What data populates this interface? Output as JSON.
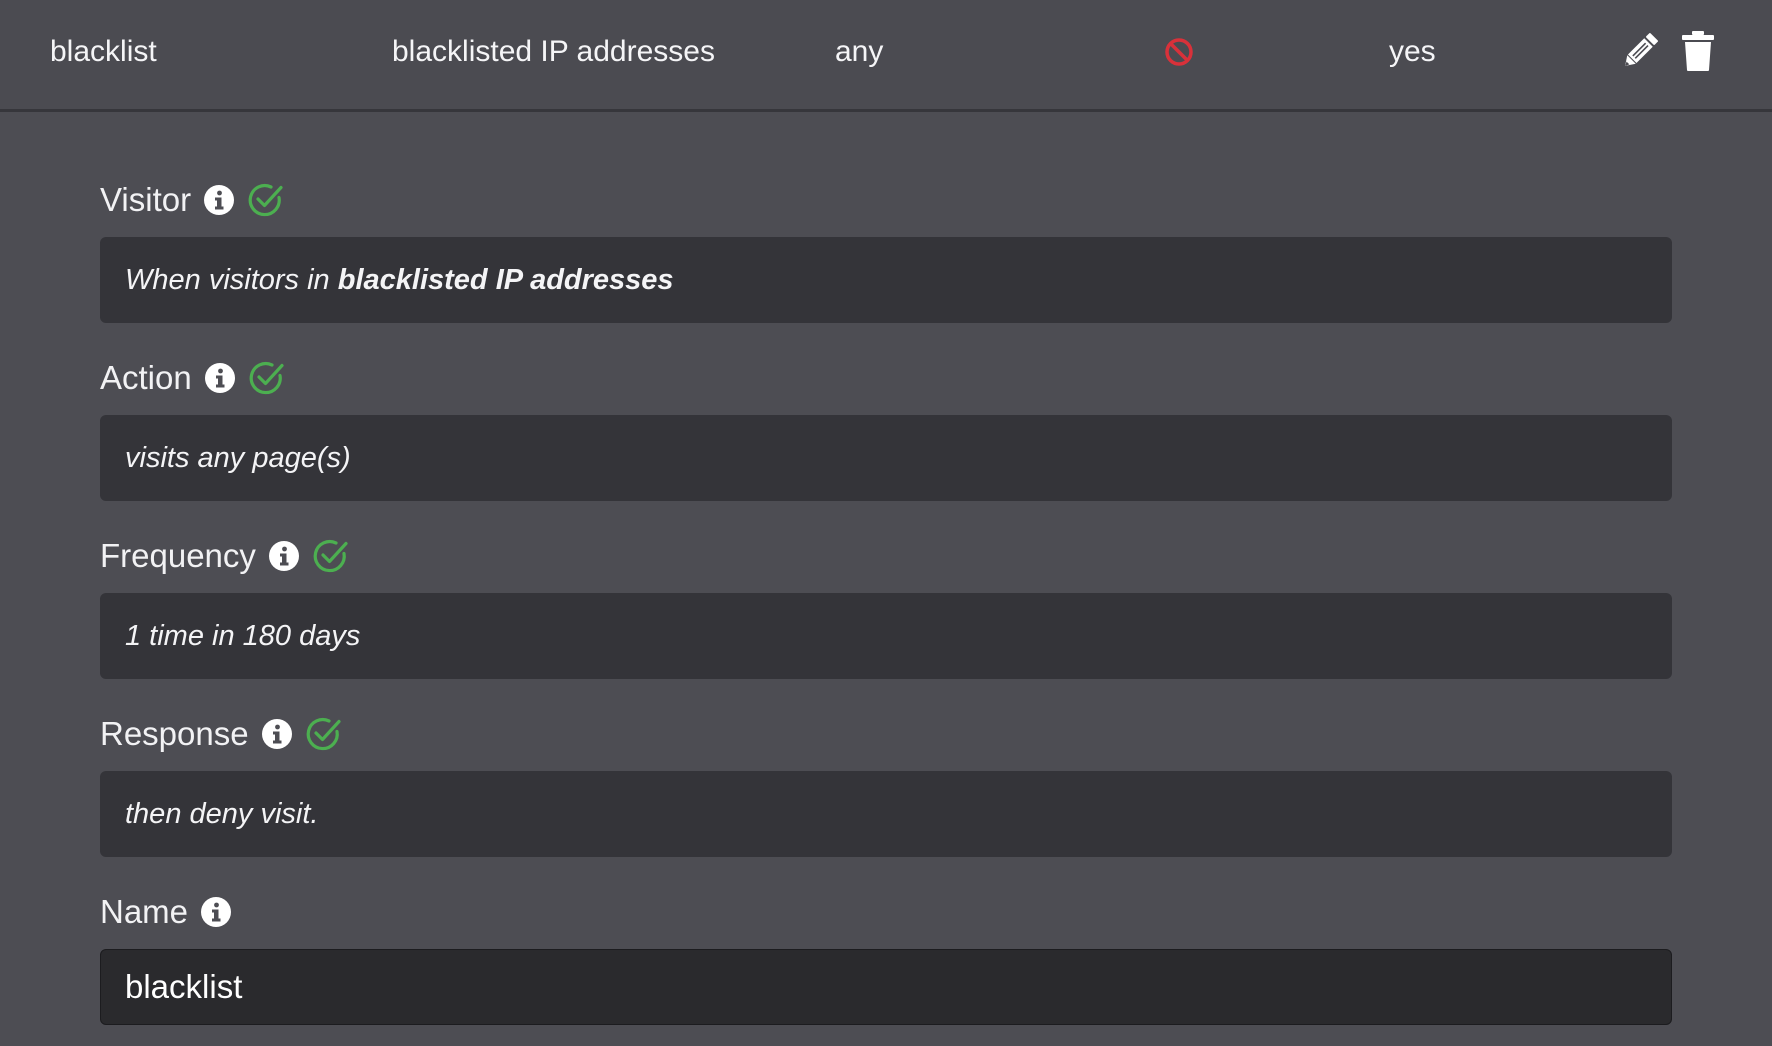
{
  "rule_row": {
    "name": "blacklist",
    "visitor": "blacklisted IP addresses",
    "action": "any",
    "status_icon": "blocked-icon",
    "enabled": "yes",
    "edit_icon": "pencil-icon",
    "delete_icon": "trash-icon"
  },
  "fields": {
    "visitor": {
      "label": "Visitor",
      "prefix": "When visitors in ",
      "value": "blacklisted IP addresses"
    },
    "action": {
      "label": "Action",
      "prefix": "visits ",
      "value": "any page(s)"
    },
    "frequency": {
      "label": "Frequency",
      "value": "1 time in 180 days"
    },
    "response": {
      "label": "Response",
      "value": "then deny visit."
    },
    "name": {
      "label": "Name",
      "value": "blacklist"
    }
  },
  "colors": {
    "background": "#4d4d53",
    "field_bg": "#343439",
    "input_bg": "#2a2a2d",
    "check_green": "#4caf50",
    "blocked_red": "#d9313a"
  }
}
